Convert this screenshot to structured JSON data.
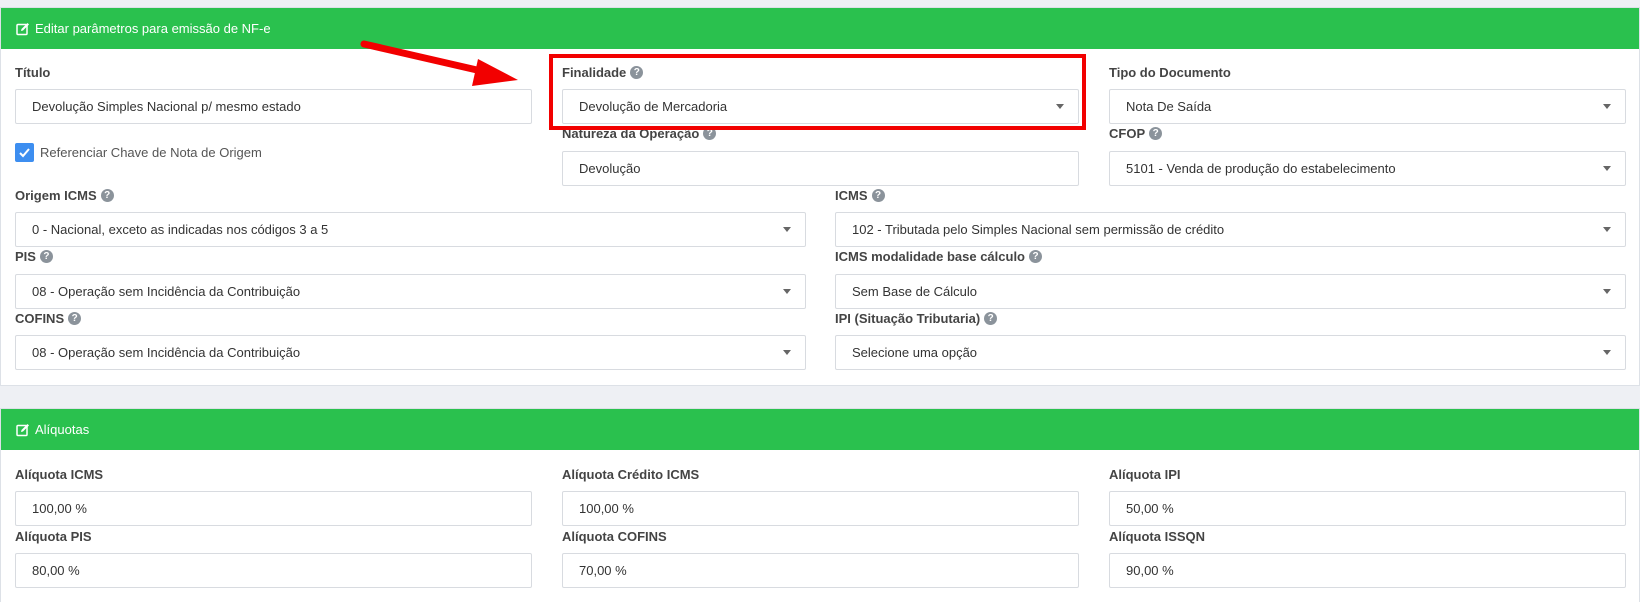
{
  "panel1": {
    "title": "Editar parâmetros para emissão de NF-e",
    "titulo": {
      "label": "Título",
      "value": "Devolução Simples Nacional p/ mesmo estado"
    },
    "finalidade": {
      "label": "Finalidade",
      "value": "Devolução de Mercadoria"
    },
    "tipo_documento": {
      "label": "Tipo do Documento",
      "value": "Nota De Saída"
    },
    "referenciar": {
      "label": "Referenciar Chave de Nota de Origem",
      "checked": true
    },
    "natureza": {
      "label": "Natureza da Operação",
      "value": "Devolução"
    },
    "cfop": {
      "label": "CFOP",
      "value": "5101 - Venda de produção do estabelecimento"
    },
    "origem_icms": {
      "label": "Origem ICMS",
      "value": "0 - Nacional, exceto as indicadas nos códigos 3 a 5"
    },
    "icms": {
      "label": "ICMS",
      "value": "102 - Tributada pelo Simples Nacional sem permissão de crédito"
    },
    "pis": {
      "label": "PIS",
      "value": "08 - Operação sem Incidência da Contribuição"
    },
    "icms_modalidade": {
      "label": "ICMS modalidade base cálculo",
      "value": "Sem Base de Cálculo"
    },
    "cofins": {
      "label": "COFINS",
      "value": "08 - Operação sem Incidência da Contribuição"
    },
    "ipi": {
      "label": "IPI (Situação Tributaria)",
      "value": "Selecione uma opção"
    }
  },
  "panel2": {
    "title": "Alíquotas",
    "aliquota_icms": {
      "label": "Alíquota ICMS",
      "value": "100,00 %"
    },
    "aliquota_credito_icms": {
      "label": "Alíquota Crédito ICMS",
      "value": "100,00 %"
    },
    "aliquota_ipi": {
      "label": "Alíquota IPI",
      "value": "50,00 %"
    },
    "aliquota_pis": {
      "label": "Alíquota PIS",
      "value": "80,00 %"
    },
    "aliquota_cofins": {
      "label": "Alíquota COFINS",
      "value": "70,00 %"
    },
    "aliquota_issqn": {
      "label": "Alíquota ISSQN",
      "value": "90,00 %"
    }
  },
  "icons": {
    "help": "?"
  },
  "colors": {
    "header_green": "#2ac14e",
    "highlight_red": "#f20000",
    "checkbox_blue": "#3d8ef0"
  }
}
